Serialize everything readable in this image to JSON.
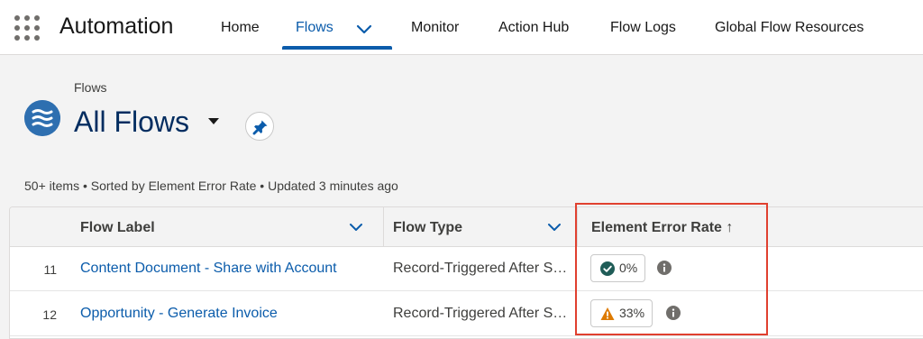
{
  "app": {
    "name": "Automation"
  },
  "nav": {
    "items": [
      {
        "label": "Home"
      },
      {
        "label": "Flows",
        "active": true
      },
      {
        "label": "Monitor"
      },
      {
        "label": "Action Hub"
      },
      {
        "label": "Flow Logs"
      },
      {
        "label": "Global Flow Resources"
      }
    ]
  },
  "header": {
    "object_label": "Flows",
    "list_title": "All Flows",
    "icon": "flow-icon",
    "pin_icon": "pin-icon"
  },
  "meta": "50+ items • Sorted by Element Error Rate • Updated 3 minutes ago",
  "table": {
    "columns": [
      {
        "label": "Flow Label"
      },
      {
        "label": "Flow Type"
      },
      {
        "label": "Element Error Rate ↑"
      }
    ],
    "rows": [
      {
        "number": "11",
        "label": "Content Document - Share with Account",
        "type": "Record-Triggered After Save",
        "error_rate": "0%",
        "status_icon": "success-check-icon",
        "status_color": "#2e844a"
      },
      {
        "number": "12",
        "label": "Opportunity - Generate Invoice",
        "type": "Record-Triggered After Save",
        "error_rate": "33%",
        "status_icon": "warning-icon",
        "status_color": "#dd7a01"
      }
    ]
  },
  "colors": {
    "brand_blue": "#0b5cab",
    "title_navy": "#032d60",
    "highlight_red": "#e0402f"
  }
}
